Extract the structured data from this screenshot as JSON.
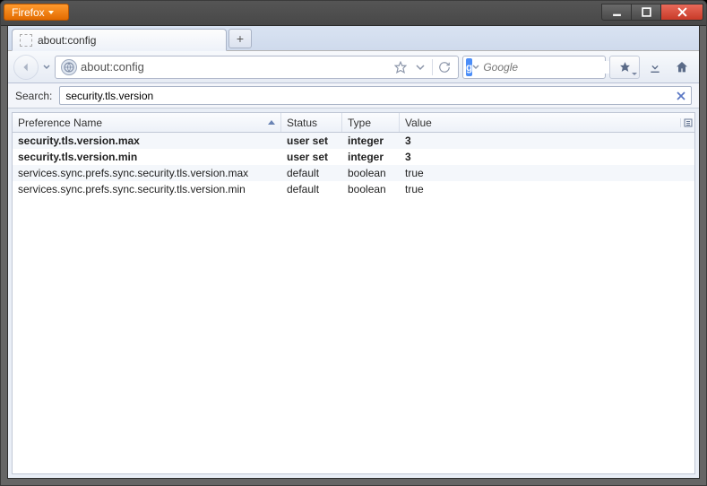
{
  "app": {
    "name": "Firefox"
  },
  "tab": {
    "title": "about:config"
  },
  "navbar": {
    "url": "about:config",
    "search_engine_badge": "g",
    "search_placeholder": "Google"
  },
  "filter": {
    "label": "Search:",
    "value": "security.tls.version"
  },
  "columns": {
    "name": "Preference Name",
    "status": "Status",
    "type": "Type",
    "value": "Value"
  },
  "rows": [
    {
      "name": "security.tls.version.max",
      "status": "user set",
      "type": "integer",
      "value": "3",
      "bold": true
    },
    {
      "name": "security.tls.version.min",
      "status": "user set",
      "type": "integer",
      "value": "3",
      "bold": true
    },
    {
      "name": "services.sync.prefs.sync.security.tls.version.max",
      "status": "default",
      "type": "boolean",
      "value": "true",
      "bold": false
    },
    {
      "name": "services.sync.prefs.sync.security.tls.version.min",
      "status": "default",
      "type": "boolean",
      "value": "true",
      "bold": false
    }
  ]
}
